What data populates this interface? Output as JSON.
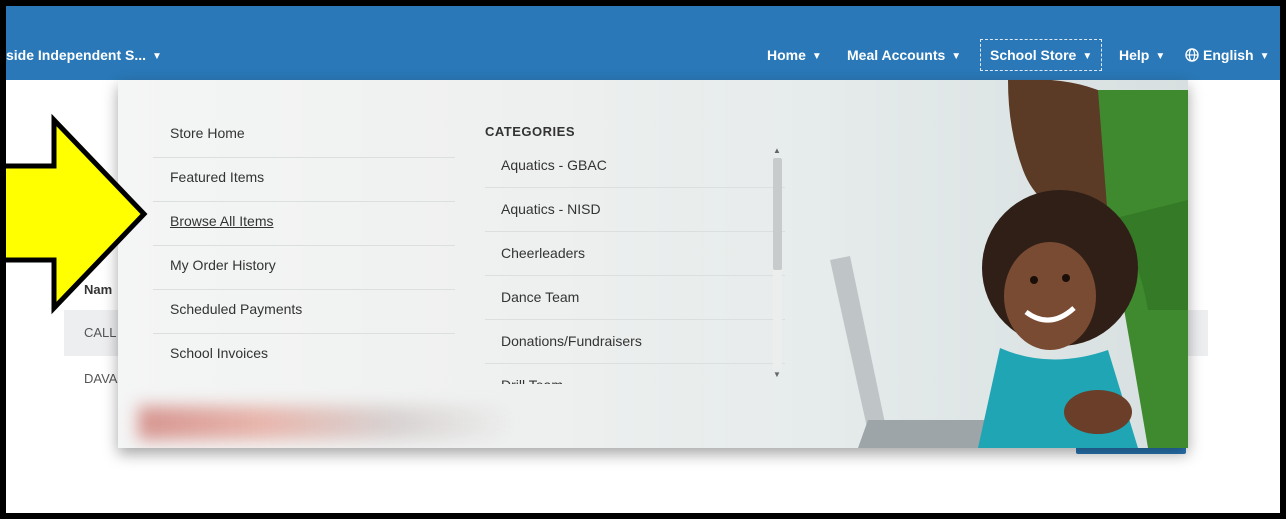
{
  "header": {
    "district_name": "side Independent S...",
    "nav": [
      {
        "label": "Home"
      },
      {
        "label": "Meal Accounts"
      },
      {
        "label": "School Store"
      },
      {
        "label": "Help"
      },
      {
        "label": "English"
      }
    ]
  },
  "background": {
    "name_header": "Nam",
    "rows": [
      "CALL",
      "DAVA"
    ]
  },
  "store_menu": {
    "items": [
      {
        "label": "Store Home"
      },
      {
        "label": "Featured Items"
      },
      {
        "label": "Browse All Items"
      },
      {
        "label": "My Order History"
      },
      {
        "label": "Scheduled Payments"
      },
      {
        "label": "School Invoices"
      }
    ]
  },
  "categories": {
    "title": "CATEGORIES",
    "items": [
      {
        "label": "Aquatics - GBAC"
      },
      {
        "label": "Aquatics - NISD"
      },
      {
        "label": "Cheerleaders"
      },
      {
        "label": "Dance Team"
      },
      {
        "label": "Donations/Fundraisers"
      },
      {
        "label": "Drill Team"
      }
    ]
  },
  "colors": {
    "nav_blue": "#2a78b7",
    "arrow_yellow": "#ffff00",
    "border": "#000000"
  },
  "icons": {
    "dropdown": "caret-down-icon",
    "language": "globe-icon"
  }
}
